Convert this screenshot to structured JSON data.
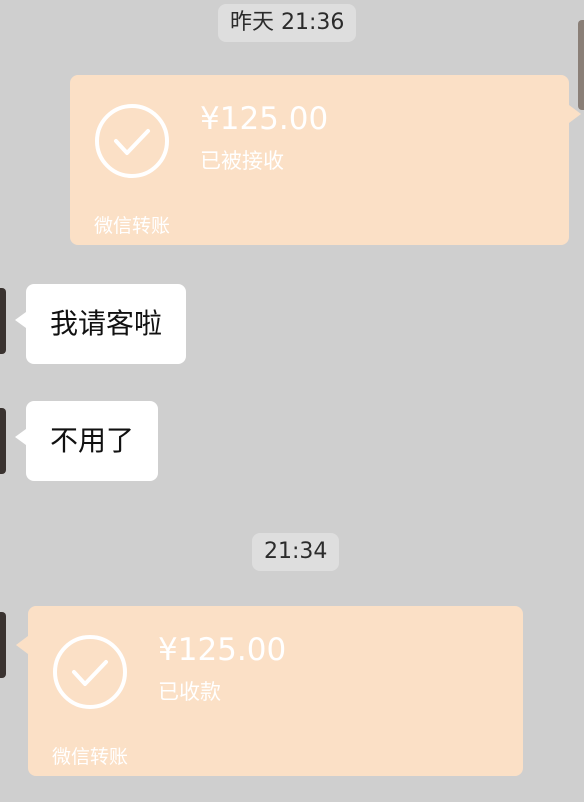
{
  "timestamps": [
    "昨天 21:36",
    "21:34"
  ],
  "transfer_sent": {
    "amount": "¥125.00",
    "status": "已被接收",
    "footer": "微信转账"
  },
  "messages": [
    {
      "text": "我请客啦"
    },
    {
      "text": "不用了"
    }
  ],
  "transfer_received": {
    "amount": "¥125.00",
    "status": "已收款",
    "footer": "微信转账"
  },
  "colors": {
    "background": "#cfcfcf",
    "transfer_card": "#fbe0c6",
    "bubble": "#ffffff"
  }
}
